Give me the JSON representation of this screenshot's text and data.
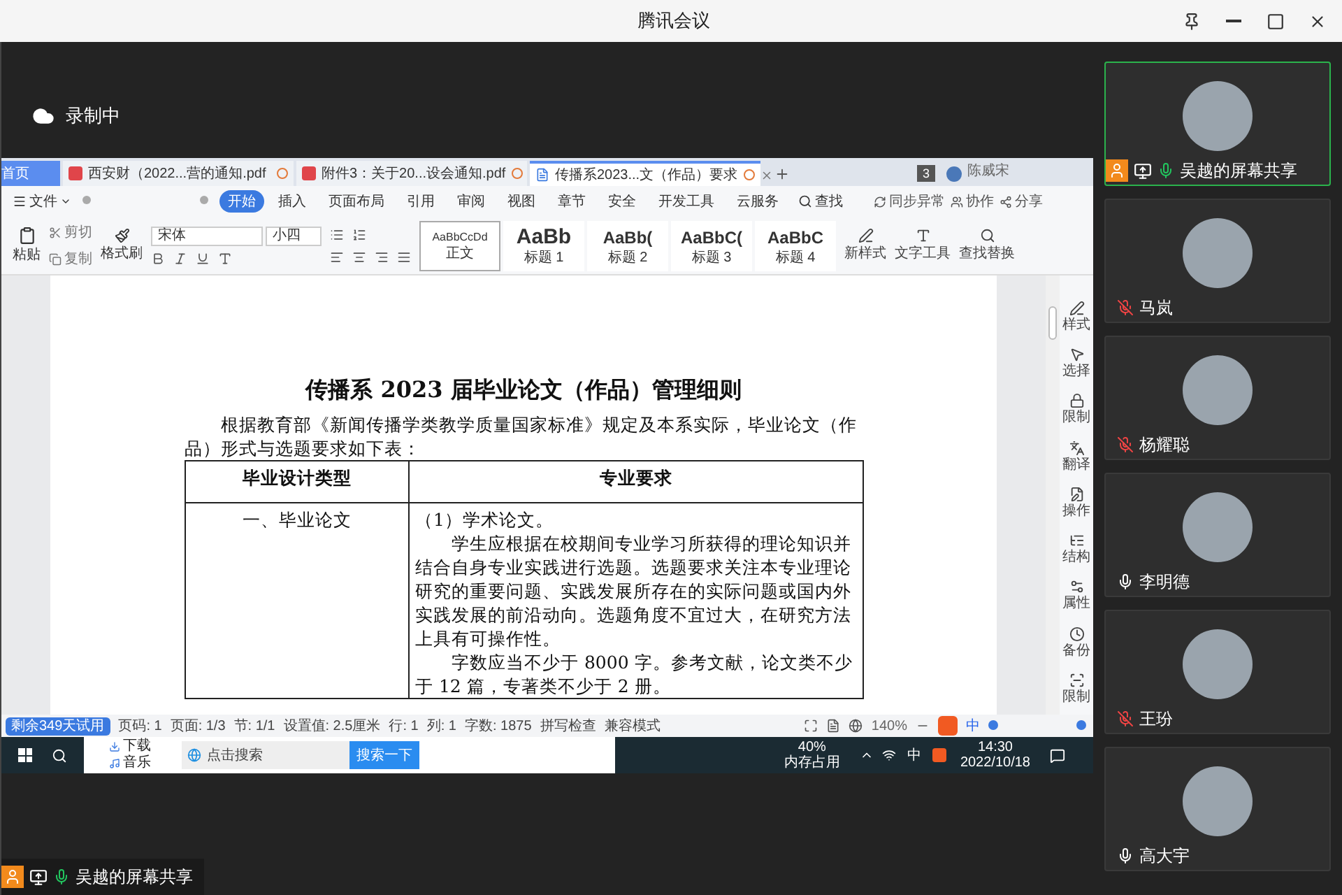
{
  "window": {
    "title": "腾讯会议"
  },
  "recording": {
    "label": "录制中"
  },
  "shared_screen": {
    "tabs": [
      {
        "label": "首页",
        "kind": "home",
        "selected": false
      },
      {
        "label": "西安财（2022...营的通知.pdf",
        "kind": "pdf",
        "selected": false
      },
      {
        "label": "附件3：关于20...设会通知.pdf",
        "kind": "pdf",
        "selected": false
      },
      {
        "label": "传播系2023...文（作品）要求",
        "kind": "doc",
        "selected": true
      }
    ],
    "tab_count": "3",
    "account_name": "陈威宋",
    "menu": [
      {
        "label": "开始",
        "selected": true
      },
      {
        "label": "插入",
        "selected": false
      },
      {
        "label": "页面布局",
        "selected": false
      },
      {
        "label": "引用",
        "selected": false
      },
      {
        "label": "审阅",
        "selected": false
      },
      {
        "label": "视图",
        "selected": false
      },
      {
        "label": "章节",
        "selected": false
      },
      {
        "label": "安全",
        "selected": false
      },
      {
        "label": "开发工具",
        "selected": false
      },
      {
        "label": "云服务",
        "selected": false
      }
    ],
    "file_menu": "文件",
    "find": "查找",
    "sync": "同步异常",
    "collab": "协作",
    "share": "分享",
    "clipboard": {
      "paste": "粘贴",
      "cut": "剪切",
      "copy": "复制",
      "format_painter": "格式刷"
    },
    "font_name": "宋体",
    "font_size": "小四",
    "styles": [
      {
        "sample": "AaBbCcDd",
        "name": "正文",
        "selected": true
      },
      {
        "sample": "AaBb",
        "name": "标题 1",
        "selected": false
      },
      {
        "sample": "AaBb(",
        "name": "标题 2",
        "selected": false
      },
      {
        "sample": "AaBbC(",
        "name": "标题 3",
        "selected": false
      },
      {
        "sample": "AaBbC",
        "name": "标题 4",
        "selected": false
      }
    ],
    "ribbon_buttons": [
      "新样式",
      "文字工具",
      "查找替换"
    ],
    "document": {
      "title": "传播系 2023 届毕业论文（作品）管理细则",
      "intro": "根据教育部《新闻传播学类教学质量国家标准》规定及本系实际，毕业论文（作品）形式与选题要求如下表：",
      "table": {
        "columns": [
          "毕业设计类型",
          "专业要求"
        ],
        "rows": [
          {
            "type": "一、毕业论文",
            "paragraphs": [
              "（1）学术论文。",
              "学生应根据在校期间专业学习所获得的理论知识并结合自身专业实践进行选题。选题要求关注本专业理论研究的重要问题、实践发展所存在的实际问题或国内外实践发展的前沿动向。选题角度不宜过大，在研究方法上具有可操作性。",
              "字数应当不少于 8000 字。参考文献，论文类不少于 12 篇，专著类不少于 2 册。"
            ]
          }
        ]
      }
    },
    "side_panel": [
      "样式",
      "选择",
      "限制",
      "翻译",
      "操作",
      "结构",
      "属性",
      "备份",
      "限制"
    ],
    "status": {
      "trial": "剩余349天试用",
      "fields": [
        "页码: 1",
        "页面: 1/3",
        "节: 1/1",
        "设置值: 2.5厘米",
        "行: 1",
        "列: 1",
        "字数: 1875"
      ],
      "spell_check": "拼写检查",
      "compat": "兼容模式",
      "zoom": "140%",
      "ime": "中"
    },
    "taskbar": {
      "quick_items": [
        "下载",
        "音乐"
      ],
      "search_placeholder": "点击搜索",
      "search_button": "搜索一下",
      "memory_value": "40%",
      "memory_label": "内存占用",
      "ime": "中",
      "time": "14:30",
      "date": "2022/10/18"
    }
  },
  "share_label": "吴越的屏幕共享",
  "participants": [
    {
      "name": "吴越的屏幕共享",
      "kind": "screen_share",
      "muted": false,
      "selected": true
    },
    {
      "name": "马岚",
      "kind": "person",
      "muted": true,
      "selected": false
    },
    {
      "name": "杨耀聪",
      "kind": "person",
      "muted": true,
      "selected": false
    },
    {
      "name": "李明德",
      "kind": "person",
      "muted": false,
      "selected": false
    },
    {
      "name": "王玢",
      "kind": "person",
      "muted": true,
      "selected": false
    },
    {
      "name": "高大宇",
      "kind": "person",
      "muted": false,
      "selected": false
    }
  ]
}
